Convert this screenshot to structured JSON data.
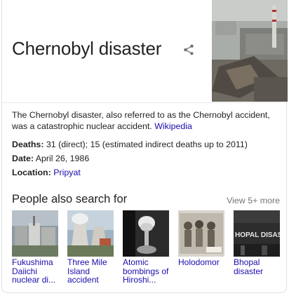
{
  "entity": {
    "title": "Chernobyl disaster",
    "description": "The Chernobyl disaster, also referred to as the Chernobyl accident, was a catastrophic nuclear accident.",
    "source_link": "Wikipedia"
  },
  "facts": [
    {
      "label": "Deaths:",
      "value": "31 (direct); 15 (estimated indirect deaths up to 2011)"
    },
    {
      "label": "Date:",
      "value": "April 26, 1986"
    },
    {
      "label": "Location:",
      "value": "Pripyat",
      "is_link": true
    }
  ],
  "people_also_search": {
    "title": "People also search for",
    "view_more": "View 5+ more",
    "items": [
      {
        "label": "Fukushima Daiichi nuclear di..."
      },
      {
        "label": "Three Mile Island accident"
      },
      {
        "label": "Atomic bombings of Hiroshi..."
      },
      {
        "label": "Holodomor"
      },
      {
        "label": "Bhopal disaster",
        "thumb_text": "HOPAL DISAST"
      }
    ]
  },
  "icons": {
    "share": "share-icon"
  },
  "colors": {
    "link": "#1a0dab",
    "muted": "#70757a",
    "text": "#222222",
    "border": "#dfe1e5"
  }
}
